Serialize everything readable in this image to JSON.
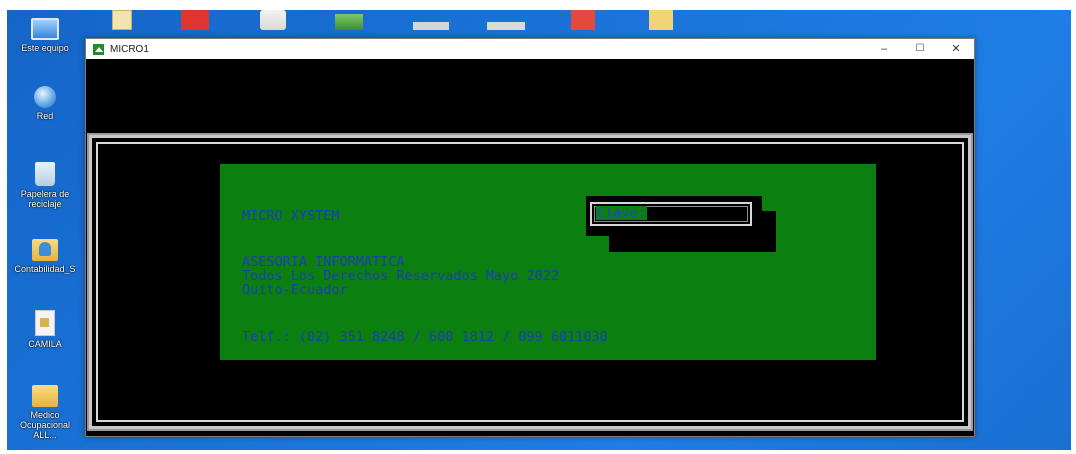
{
  "desktop": {
    "icons": [
      {
        "label": "Este equipo",
        "icon": "computer-icon"
      },
      {
        "label": "Red",
        "icon": "network-icon"
      },
      {
        "label": "Papelera de reciclaje",
        "icon": "recycle-bin-icon"
      },
      {
        "label": "Contabilidad_S",
        "icon": "user-folder-icon"
      },
      {
        "label": "CAMILA",
        "icon": "document-icon"
      },
      {
        "label": "Medico Ocupacional ALL...",
        "icon": "folder-icon"
      }
    ]
  },
  "window": {
    "title": "MICRO1",
    "controls": {
      "minimize": "–",
      "maximize": "☐",
      "close": "✕"
    }
  },
  "console": {
    "company": "MICRO XYSTEM",
    "clave_label": "Clave:",
    "line1": "ASESORIA INFORMATICA",
    "line2": "Todos Los Derechos Reservados Mayo 2022",
    "line3": "Quito-Ecuador",
    "phone": "Telf.: (02) 351 8248 / 600 1812 / 099 6011030"
  },
  "colors": {
    "desktop": "#1a73d8",
    "panel": "#0b7f0f",
    "text": "#1b3dbb"
  }
}
